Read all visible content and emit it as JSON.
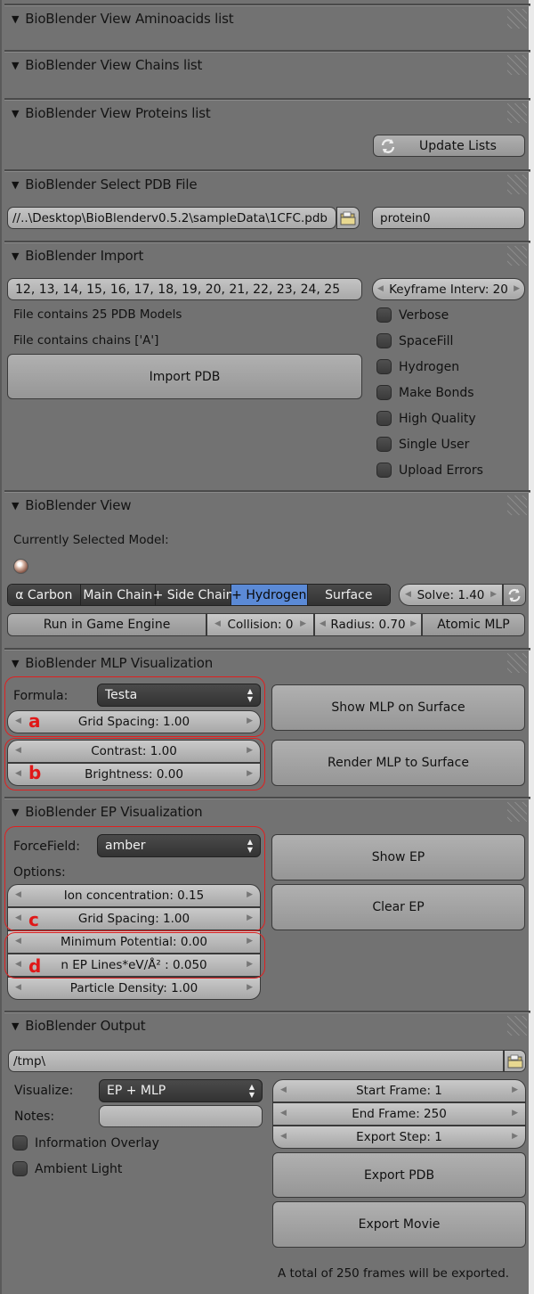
{
  "panels": {
    "aminoacids": {
      "title": "BioBlender View Aminoacids list"
    },
    "chains": {
      "title": "BioBlender View Chains list"
    },
    "proteins": {
      "title": "BioBlender View Proteins list",
      "update_button": "Update Lists"
    },
    "select_pdb": {
      "title": "BioBlender Select PDB File",
      "file_path": "//..\\Desktop\\BioBlenderv0.5.2\\sampleData\\1CFC.pdb",
      "protein_name": "protein0"
    },
    "import": {
      "title": "BioBlender Import",
      "models_field": "12, 13, 14, 15, 16, 17, 18, 19, 20, 21, 22, 23, 24, 25",
      "keyframe": "Keyframe Interv: 20",
      "info_models": "File contains 25 PDB Models",
      "info_chains": "File contains chains ['A']",
      "import_button": "Import PDB",
      "options": [
        {
          "label": "Verbose",
          "checked": false
        },
        {
          "label": "SpaceFill",
          "checked": false
        },
        {
          "label": "Hydrogen",
          "checked": false
        },
        {
          "label": "Make Bonds",
          "checked": false
        },
        {
          "label": "High Quality",
          "checked": false
        },
        {
          "label": "Single User",
          "checked": false
        },
        {
          "label": "Upload Errors",
          "checked": false
        }
      ]
    },
    "view": {
      "title": "BioBlender View",
      "selected_label": "Currently Selected Model:",
      "modes": [
        {
          "label": "α Carbon",
          "active": false
        },
        {
          "label": "Main Chain",
          "active": false
        },
        {
          "label": "+ Side Chain",
          "active": false
        },
        {
          "label": "+ Hydrogen",
          "active": true
        },
        {
          "label": "Surface",
          "active": false
        }
      ],
      "solve": "Solve: 1.40",
      "run_game_engine": "Run in Game Engine",
      "collision": "Collision: 0",
      "radius": "Radius: 0.70",
      "atomic_mlp": "Atomic MLP"
    },
    "mlp": {
      "title": "BioBlender MLP Visualization",
      "formula_label": "Formula:",
      "formula_value": "Testa",
      "grid_spacing": "Grid Spacing: 1.00",
      "contrast": "Contrast: 1.00",
      "brightness": "Brightness: 0.00",
      "show_button": "Show MLP on Surface",
      "render_button": "Render MLP to Surface",
      "annotation_a": "a",
      "annotation_b": "b"
    },
    "ep": {
      "title": "BioBlender EP Visualization",
      "forcefield_label": "ForceField:",
      "forcefield_value": "amber",
      "options_label": "Options:",
      "ion_concentration": "Ion concentration: 0.15",
      "grid_spacing": "Grid Spacing: 1.00",
      "min_potential": "Minimum Potential: 0.00",
      "ep_lines": "n EP Lines*eV/Å² : 0.050",
      "particle_density": "Particle Density: 1.00",
      "show_button": "Show EP",
      "clear_button": "Clear EP",
      "annotation_c": "c",
      "annotation_d": "d"
    },
    "output": {
      "title": "BioBlender Output",
      "path": "/tmp\\",
      "visualize_label": "Visualize:",
      "visualize_value": "EP + MLP",
      "notes_label": "Notes:",
      "notes_value": "",
      "info_overlay": {
        "label": "Information Overlay",
        "checked": false
      },
      "ambient_light": {
        "label": "Ambient Light",
        "checked": false
      },
      "start_frame": "Start Frame: 1",
      "end_frame": "End Frame: 250",
      "export_step": "Export Step: 1",
      "export_pdb": "Export PDB",
      "export_movie": "Export Movie",
      "summary": "A total of 250 frames will be exported."
    }
  },
  "colors": {
    "active_mode": "#5b8ad6",
    "annotation": "#e01818",
    "background": "#727272"
  }
}
